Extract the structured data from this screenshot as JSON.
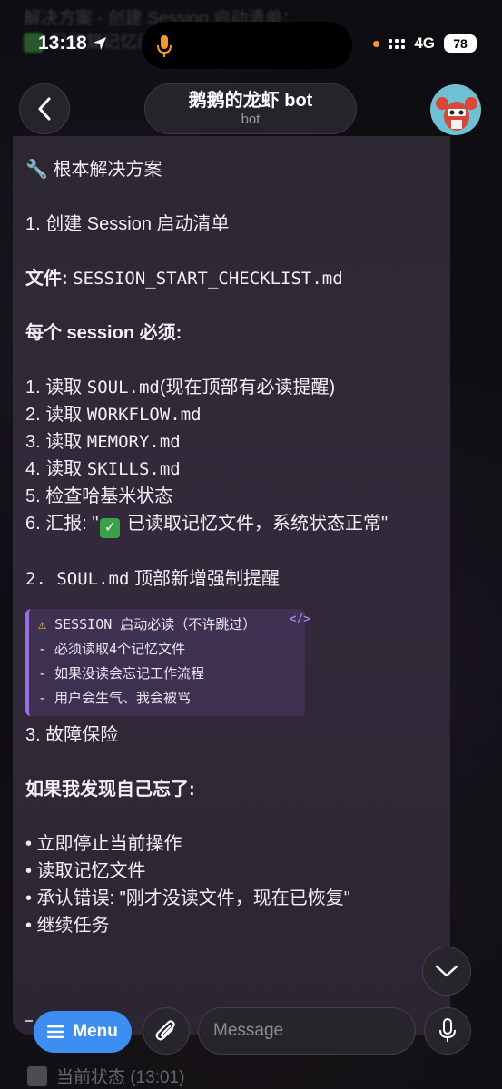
{
  "status_bar": {
    "time": "13:18",
    "network": "4G",
    "battery": "78"
  },
  "ghost_top": {
    "line1": "解决方案 - 创建 Session 启动清单：",
    "line2": "已修复记忆问题"
  },
  "header": {
    "title": "鹅鹅的龙虾 bot",
    "subtitle": "bot"
  },
  "message": {
    "heading": "🔧 根本解决方案",
    "step1_title": "1. 创建 Session 启动清单",
    "file_label": "文件:",
    "file_name": "SESSION_START_CHECKLIST.md",
    "must_title": "每个 session 必须:",
    "items": [
      {
        "num": "1. 读取 ",
        "code": "SOUL.md",
        "rest": "(现在顶部有必读提醒)"
      },
      {
        "num": "2. 读取 ",
        "code": "WORKFLOW.md",
        "rest": ""
      },
      {
        "num": "3. 读取 ",
        "code": "MEMORY.md",
        "rest": ""
      },
      {
        "num": "4. 读取 ",
        "code": "SKILLS.md",
        "rest": ""
      },
      {
        "num": "5. 检查哈基米状态",
        "code": "",
        "rest": ""
      }
    ],
    "item6_prefix": "6. 汇报: \"",
    "item6_text": " 已读取记忆文件，系统状态正常\"",
    "step2_code": "2. SOUL.md",
    "step2_rest": " 顶部新增强制提醒",
    "quote": {
      "title": "SESSION 启动必读（不许跳过）",
      "lines": [
        "- 必须读取4个记忆文件",
        "- 如果没读会忘记工作流程",
        "- 用户会生气、我会被骂"
      ]
    },
    "step3_title": "3. 故障保险",
    "forgot_title": "如果我发现自己忘了:",
    "bullets": [
      "• 立即停止当前操作",
      "• 读取记忆文件",
      "• 承认错误: \"刚才没读文件，现在已恢复\"",
      "• 继续任务"
    ]
  },
  "bottom_bar": {
    "menu_label": "Menu",
    "message_placeholder": "Message"
  },
  "bottom_ghost": {
    "text": "当前状态 (13:01)"
  }
}
